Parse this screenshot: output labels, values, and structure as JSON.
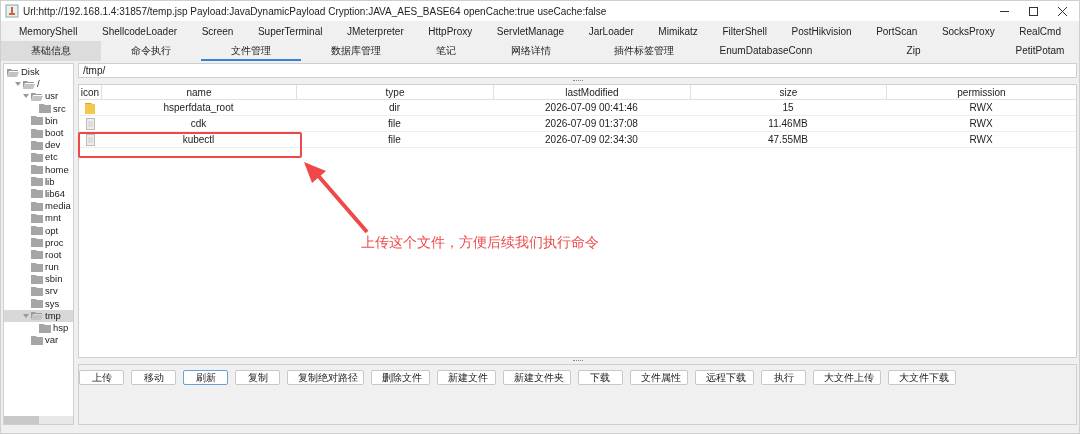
{
  "window": {
    "title": "Url:http://192.168.1.4:31857/temp.jsp Payload:JavaDynamicPayload Cryption:JAVA_AES_BASE64 openCache:true useCache:false"
  },
  "plugin_tabs": [
    {
      "label": "MemoryShell"
    },
    {
      "label": "ShellcodeLoader"
    },
    {
      "label": "Screen"
    },
    {
      "label": "SuperTerminal"
    },
    {
      "label": "JMeterpreter"
    },
    {
      "label": "HttpProxy"
    },
    {
      "label": "ServletManage"
    },
    {
      "label": "JarLoader"
    },
    {
      "label": "Mimikatz"
    },
    {
      "label": "FilterShell"
    },
    {
      "label": "PostHikvision"
    },
    {
      "label": "PortScan"
    },
    {
      "label": "SocksProxy"
    },
    {
      "label": "RealCmd"
    }
  ],
  "tabs": [
    {
      "label": "基础信息",
      "selected": false,
      "hovered": true
    },
    {
      "label": "命令执行",
      "selected": false,
      "hovered": false
    },
    {
      "label": "文件管理",
      "selected": true,
      "hovered": false
    },
    {
      "label": "数据库管理",
      "selected": false,
      "hovered": false
    },
    {
      "label": "笔记",
      "selected": false,
      "hovered": false
    },
    {
      "label": "网络详情",
      "selected": false,
      "hovered": false
    },
    {
      "label": "插件标签管理",
      "selected": false,
      "hovered": false
    },
    {
      "label": "EnumDatabaseConn",
      "selected": false,
      "hovered": false
    },
    {
      "label": "Zip",
      "selected": false,
      "hovered": false
    },
    {
      "label": "PetitPotam",
      "selected": false,
      "hovered": false
    }
  ],
  "tree": [
    {
      "label": "Disk",
      "selected": false,
      "children": [
        {
          "label": "/",
          "selected": false,
          "expanded": true,
          "children": [
            {
              "label": "usr",
              "selected": false,
              "expanded": true,
              "children": [
                {
                  "label": "src",
                  "selected": false
                }
              ]
            },
            {
              "label": "bin",
              "selected": false
            },
            {
              "label": "boot",
              "selected": false
            },
            {
              "label": "dev",
              "selected": false
            },
            {
              "label": "etc",
              "selected": false
            },
            {
              "label": "home",
              "selected": false
            },
            {
              "label": "lib",
              "selected": false
            },
            {
              "label": "lib64",
              "selected": false
            },
            {
              "label": "media",
              "selected": false
            },
            {
              "label": "mnt",
              "selected": false
            },
            {
              "label": "opt",
              "selected": false
            },
            {
              "label": "proc",
              "selected": false
            },
            {
              "label": "root",
              "selected": false
            },
            {
              "label": "run",
              "selected": false
            },
            {
              "label": "sbin",
              "selected": false
            },
            {
              "label": "srv",
              "selected": false
            },
            {
              "label": "sys",
              "selected": false
            },
            {
              "label": "tmp",
              "selected": true,
              "expanded": true,
              "children": [
                {
                  "label": "hsp",
                  "selected": false
                }
              ]
            },
            {
              "label": "var",
              "selected": false
            }
          ]
        }
      ]
    }
  ],
  "path": "/tmp/",
  "table": {
    "columns": [
      "icon",
      "name",
      "type",
      "lastModified",
      "size",
      "permission"
    ],
    "rows": [
      {
        "kind": "folder",
        "name": "hsperfdata_root",
        "type": "dir",
        "lastModified": "2026-07-09 00:41:46",
        "size": "15",
        "permission": "RWX"
      },
      {
        "kind": "file",
        "name": "cdk",
        "type": "file",
        "lastModified": "2026-07-09 01:37:08",
        "size": "11.46MB",
        "permission": "RWX"
      },
      {
        "kind": "file",
        "name": "kubectl",
        "type": "file",
        "lastModified": "2026-07-09 02:34:30",
        "size": "47.55MB",
        "permission": "RWX"
      }
    ]
  },
  "buttons": [
    {
      "label": "上传",
      "focused": false
    },
    {
      "label": "移动",
      "focused": false
    },
    {
      "label": "刷新",
      "focused": true
    },
    {
      "label": "复制",
      "focused": false
    },
    {
      "label": "复制绝对路径",
      "focused": false
    },
    {
      "label": "删除文件",
      "focused": false
    },
    {
      "label": "新建文件",
      "focused": false
    },
    {
      "label": "新建文件夹",
      "focused": false
    },
    {
      "label": "下载",
      "focused": false
    },
    {
      "label": "文件属性",
      "focused": false
    },
    {
      "label": "远程下载",
      "focused": false
    },
    {
      "label": "执行",
      "focused": false
    },
    {
      "label": "大文件上传",
      "focused": false
    },
    {
      "label": "大文件下载",
      "focused": false
    }
  ],
  "annotation": {
    "text": "上传这个文件，方便后续我们执行命令"
  }
}
